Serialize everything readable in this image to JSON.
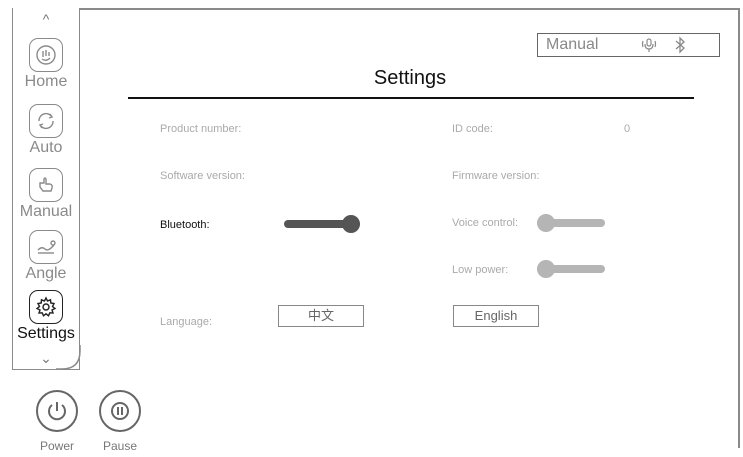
{
  "status": {
    "mode": "Manual",
    "mic_icon": "voice-icon",
    "bt_icon": "bluetooth-icon"
  },
  "page": {
    "title": "Settings"
  },
  "sidebar": {
    "up_chevron": "^",
    "down_chevron": "⌄",
    "items": [
      {
        "label": "Home",
        "icon": "hand-wave-icon"
      },
      {
        "label": "Auto",
        "icon": "hand-cycle-icon"
      },
      {
        "label": "Manual",
        "icon": "hand-point-icon"
      },
      {
        "label": "Angle",
        "icon": "recline-icon"
      },
      {
        "label": "Settings",
        "icon": "gear-icon",
        "active": true
      }
    ]
  },
  "fields": {
    "product_number": {
      "label": "Product number:",
      "value": ""
    },
    "id_code": {
      "label": "ID code:",
      "value": "0"
    },
    "software_version": {
      "label": "Software version:",
      "value": ""
    },
    "firmware_version": {
      "label": "Firmware version:",
      "value": ""
    },
    "bluetooth": {
      "label": "Bluetooth:",
      "state": "on"
    },
    "voice_control": {
      "label": "Voice control:",
      "state": "off"
    },
    "low_power": {
      "label": "Low power:",
      "state": "off"
    },
    "language": {
      "label": "Language:",
      "options": [
        "中文",
        "English"
      ]
    }
  },
  "bottom": {
    "power_label": "Power",
    "pause_label": "Pause"
  }
}
